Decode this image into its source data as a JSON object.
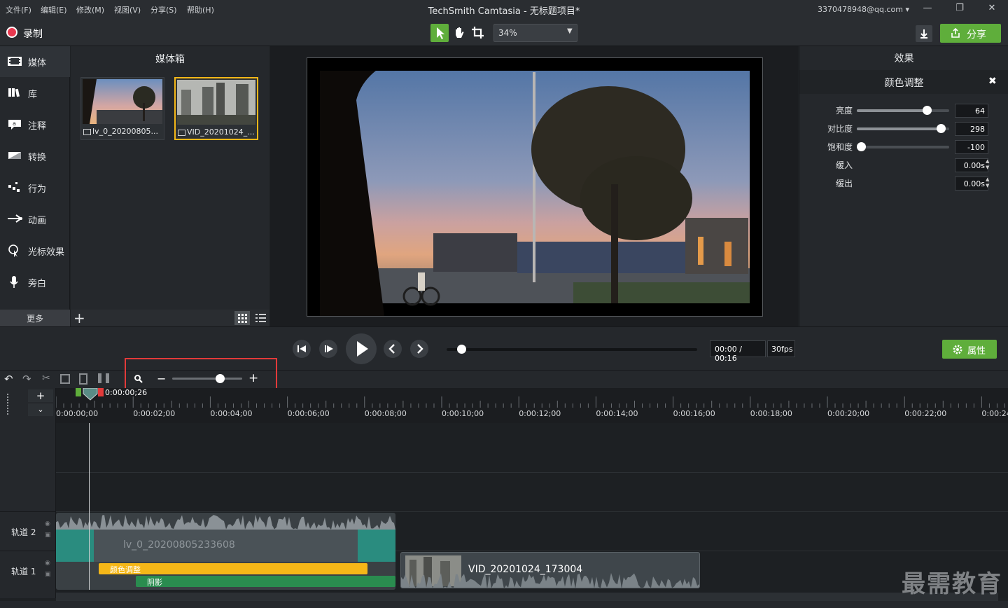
{
  "menu": {
    "file": "文件(F)",
    "edit": "编辑(E)",
    "modify": "修改(M)",
    "view": "视图(V)",
    "share": "分享(S)",
    "help": "帮助(H)"
  },
  "window": {
    "title": "TechSmith Camtasia - 无标题项目*",
    "account": "3370478948@qq.com"
  },
  "toolbar": {
    "record_label": "录制",
    "zoom_value": "34%",
    "share_label": "分享"
  },
  "nav": {
    "items": [
      {
        "label": "媒体",
        "icon": "media-icon"
      },
      {
        "label": "库",
        "icon": "library-icon"
      },
      {
        "label": "注释",
        "icon": "annotation-icon"
      },
      {
        "label": "转换",
        "icon": "transition-icon"
      },
      {
        "label": "行为",
        "icon": "behavior-icon"
      },
      {
        "label": "动画",
        "icon": "animation-icon"
      },
      {
        "label": "光标效果",
        "icon": "cursor-effect-icon"
      },
      {
        "label": "旁白",
        "icon": "microphone-icon"
      }
    ],
    "more_label": "更多"
  },
  "mediabin": {
    "title": "媒体箱",
    "items": [
      {
        "name": "lv_0_20200805..."
      },
      {
        "name": "VID_20201024_..."
      }
    ]
  },
  "effects": {
    "title": "效果",
    "effect_name": "颜色调整",
    "properties": [
      {
        "label": "亮度",
        "value": "64",
        "level": 0.78
      },
      {
        "label": "对比度",
        "value": "298",
        "level": 0.95
      },
      {
        "label": "饱和度",
        "value": "-100",
        "level": 0.0
      },
      {
        "label": "缓入",
        "value": "0.00s"
      },
      {
        "label": "缓出",
        "value": "0.00s"
      }
    ]
  },
  "playback": {
    "time": "00:00 / 00:16",
    "fps": "30fps",
    "properties_label": "属性",
    "progress": 0.03
  },
  "timeline": {
    "playhead_time": "0:00:00;26",
    "zoom_level": 0.65,
    "ticks": [
      "0:00:00;00",
      "0:00:02;00",
      "0:00:04;00",
      "0:00:06;00",
      "0:00:08;00",
      "0:00:10;00",
      "0:00:12;00",
      "0:00:14;00",
      "0:00:16;00",
      "0:00:18;00",
      "0:00:20;00",
      "0:00:22;00",
      "0:00:24"
    ],
    "tracks": [
      {
        "label": "轨道 2"
      },
      {
        "label": "轨道 1"
      }
    ],
    "clips": {
      "clip1": "lv_0_20200805233608",
      "clip2": "VID_20201024_173004",
      "effect1": "颜色调整",
      "effect2": "阴影"
    }
  },
  "watermark": "最需教育",
  "colors": {
    "accent_green": "#5fae3b",
    "selection_yellow": "#f5b718",
    "highlight_red": "#e23a3a",
    "clip_teal": "#2a8c7f"
  }
}
